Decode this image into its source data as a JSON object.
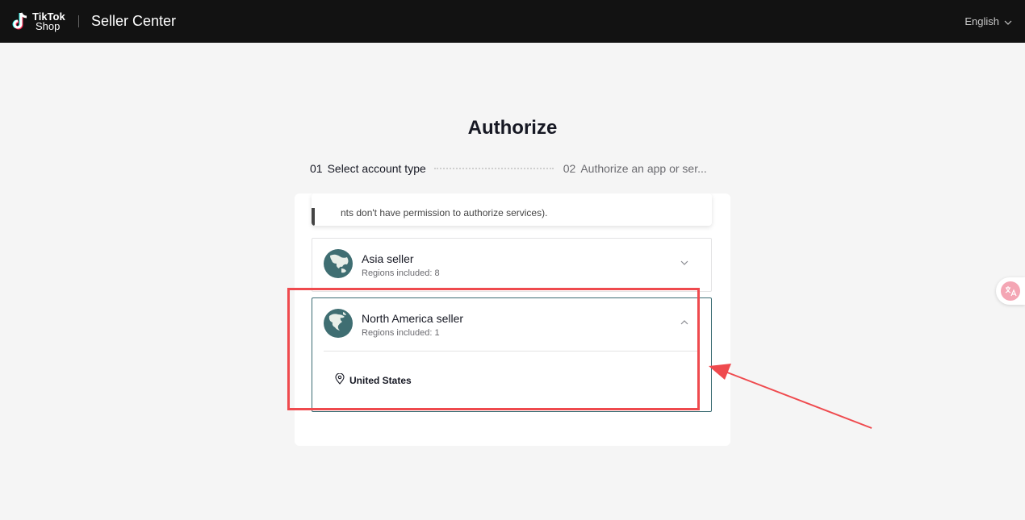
{
  "header": {
    "logo_line1": "TikTok",
    "logo_line2": "Shop",
    "brand": "Seller Center",
    "language": "English"
  },
  "page": {
    "title": "Authorize"
  },
  "steps": [
    {
      "num": "01",
      "label": "Select account type",
      "state": "active"
    },
    {
      "num": "02",
      "label": "Authorize an app or ser...",
      "state": "pending"
    }
  ],
  "notice": {
    "text": "nts don't have permission to authorize services)."
  },
  "account_types": [
    {
      "name": "Asia seller",
      "regions_text": "Regions included: 8",
      "expanded": false
    },
    {
      "name": "North America seller",
      "regions_text": "Regions included: 1",
      "expanded": true,
      "regions": [
        "United States"
      ]
    }
  ],
  "colors": {
    "header_bg": "#121212",
    "page_bg": "#f5f5f5",
    "accent_teal": "#3f6e72",
    "annotation_red": "#ef4a4e"
  },
  "icons": {
    "logo": "tiktok-note-icon",
    "language_chevron": "chevron-down-icon",
    "globe": "globe-icon",
    "location": "location-pin-icon",
    "translate": "translate-icon"
  }
}
